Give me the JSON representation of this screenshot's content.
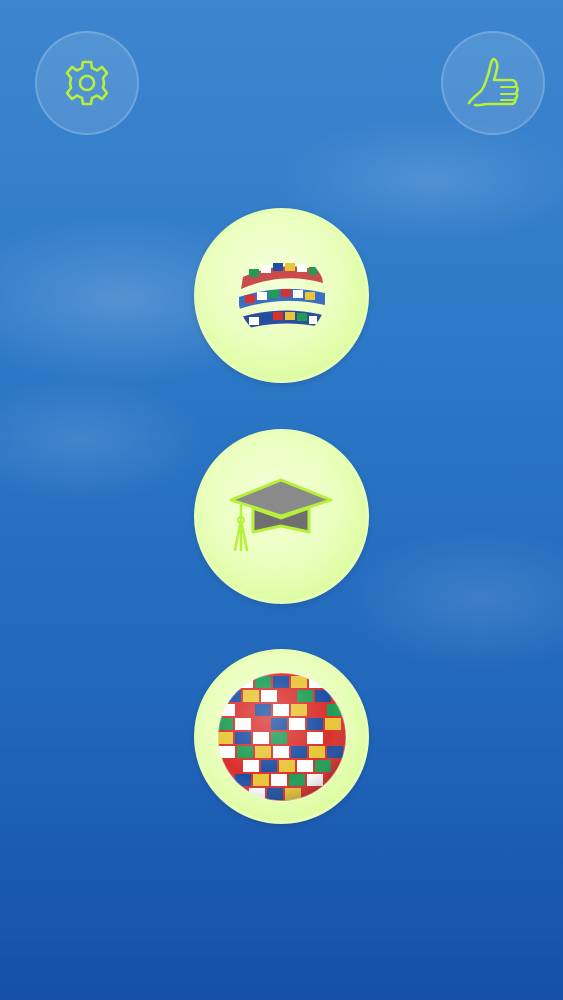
{
  "colors": {
    "background_top": "#3d86cf",
    "background_bottom": "#1650a8",
    "accent_green": "#b6f03a",
    "button_fill": "#ebffc0"
  },
  "top_bar": {
    "settings_icon": "gear-icon",
    "like_icon": "thumbs-up-icon"
  },
  "menu": {
    "items": [
      {
        "icon": "flag-ribbon-globe-icon"
      },
      {
        "icon": "graduation-cap-icon"
      },
      {
        "icon": "flag-sphere-globe-icon"
      }
    ]
  }
}
